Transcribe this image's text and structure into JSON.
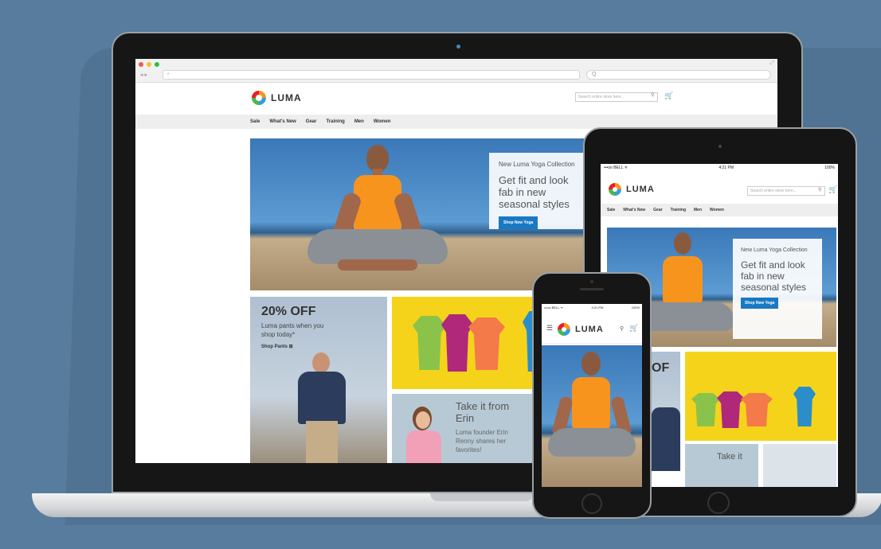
{
  "laptop": {
    "browser": {
      "url_placeholder": "+",
      "search_placeholder": "Q",
      "nav_arrows": "◂ ▸"
    },
    "site": {
      "logo_text": "LUMA",
      "search_placeholder": "Search entire store here...",
      "nav": [
        "Sale",
        "What's New",
        "Gear",
        "Training",
        "Men",
        "Women"
      ],
      "hero": {
        "kicker": "New Luma Yoga Collection",
        "title": "Get fit and look fab in new seasonal styles",
        "button": "Shop New Yoga"
      },
      "promo": {
        "title": "20% OFF",
        "body": "Luma pants when you shop today*",
        "link": "Shop Pants ⊞"
      },
      "erin": {
        "title": "Take it from Erin",
        "body": "Luma founder Erin Renny shares her favorites!"
      }
    }
  },
  "tablet": {
    "status": {
      "carrier": "•••oo BELL ᯤ",
      "time": "4:21 PM",
      "battery": "100%"
    },
    "logo_text": "LUMA",
    "search_placeholder": "Search entire store here...",
    "nav": [
      "Sale",
      "What's New",
      "Gear",
      "Training",
      "Men",
      "Women"
    ],
    "hero": {
      "kicker": "New Luma Yoga Collection",
      "title": "Get fit and look fab in new seasonal styles",
      "button": "Shop New Yoga"
    },
    "promo_title": "OF",
    "erin_title": "Take it"
  },
  "phone": {
    "status": {
      "carrier": "•••oo BELL ᯤ",
      "time": "4:21 PM",
      "battery": "100%"
    },
    "logo_text": "LUMA"
  },
  "colors": {
    "background": "#577c9d",
    "accent_button": "#1979c3",
    "promo_yellow": "#f6d31b",
    "tee_green": "#8bc34a",
    "tee_magenta": "#b0287a",
    "tee_orange": "#f47a4a",
    "tee_blue": "#2b8ec9",
    "shirt_orange": "#f7941d"
  },
  "icons": {
    "search": "search-icon",
    "cart": "cart-icon",
    "menu": "hamburger-menu-icon",
    "expand": "expand-icon"
  }
}
